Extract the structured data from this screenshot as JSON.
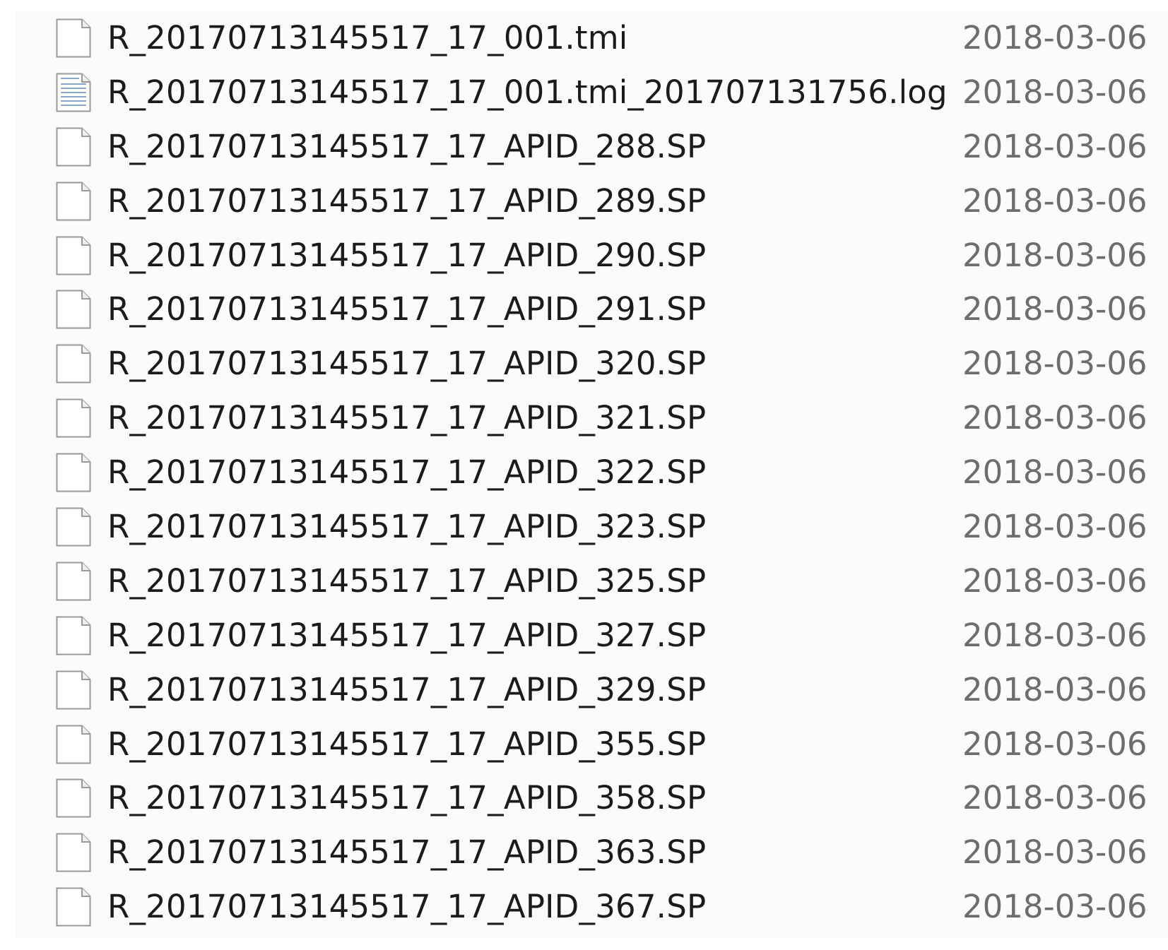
{
  "colors": {
    "pane_background": "#fbfbfb",
    "name_text": "#1b1b1b",
    "date_text": "#6d6d6d"
  },
  "files": [
    {
      "name": "R_20170713145517_17_001.tmi",
      "date": "2018-03-06",
      "icon": "blank-file-icon"
    },
    {
      "name": "R_20170713145517_17_001.tmi_201707131756.log",
      "date": "2018-03-06",
      "icon": "text-file-icon"
    },
    {
      "name": "R_20170713145517_17_APID_288.SP",
      "date": "2018-03-06",
      "icon": "blank-file-icon"
    },
    {
      "name": "R_20170713145517_17_APID_289.SP",
      "date": "2018-03-06",
      "icon": "blank-file-icon"
    },
    {
      "name": "R_20170713145517_17_APID_290.SP",
      "date": "2018-03-06",
      "icon": "blank-file-icon"
    },
    {
      "name": "R_20170713145517_17_APID_291.SP",
      "date": "2018-03-06",
      "icon": "blank-file-icon"
    },
    {
      "name": "R_20170713145517_17_APID_320.SP",
      "date": "2018-03-06",
      "icon": "blank-file-icon"
    },
    {
      "name": "R_20170713145517_17_APID_321.SP",
      "date": "2018-03-06",
      "icon": "blank-file-icon"
    },
    {
      "name": "R_20170713145517_17_APID_322.SP",
      "date": "2018-03-06",
      "icon": "blank-file-icon"
    },
    {
      "name": "R_20170713145517_17_APID_323.SP",
      "date": "2018-03-06",
      "icon": "blank-file-icon"
    },
    {
      "name": "R_20170713145517_17_APID_325.SP",
      "date": "2018-03-06",
      "icon": "blank-file-icon"
    },
    {
      "name": "R_20170713145517_17_APID_327.SP",
      "date": "2018-03-06",
      "icon": "blank-file-icon"
    },
    {
      "name": "R_20170713145517_17_APID_329.SP",
      "date": "2018-03-06",
      "icon": "blank-file-icon"
    },
    {
      "name": "R_20170713145517_17_APID_355.SP",
      "date": "2018-03-06",
      "icon": "blank-file-icon"
    },
    {
      "name": "R_20170713145517_17_APID_358.SP",
      "date": "2018-03-06",
      "icon": "blank-file-icon"
    },
    {
      "name": "R_20170713145517_17_APID_363.SP",
      "date": "2018-03-06",
      "icon": "blank-file-icon"
    },
    {
      "name": "R_20170713145517_17_APID_367.SP",
      "date": "2018-03-06",
      "icon": "blank-file-icon"
    }
  ]
}
